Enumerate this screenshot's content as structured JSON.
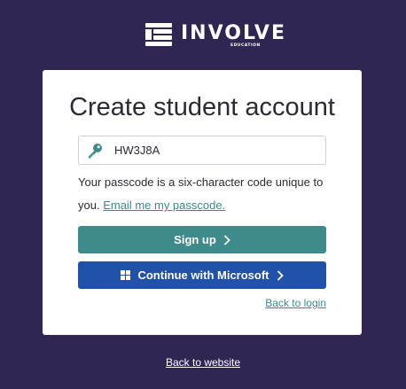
{
  "brand": {
    "name": "INVOLVE",
    "tagline": "EDUCATION"
  },
  "card": {
    "title": "Create student account",
    "passcode": {
      "value": "HW3J8A",
      "icon": "key-icon"
    },
    "help_text": "Your passcode is a six-character code unique to you.",
    "email_link": "Email me my passcode.",
    "signup_label": "Sign up",
    "microsoft_label": "Continue with Microsoft",
    "back_login_label": "Back to login"
  },
  "footer": {
    "back_website_label": "Back to website"
  },
  "colors": {
    "background": "#302651",
    "signup_button": "#3f8b8b",
    "microsoft_button": "#1f52a8",
    "link": "#3a8a8c"
  }
}
